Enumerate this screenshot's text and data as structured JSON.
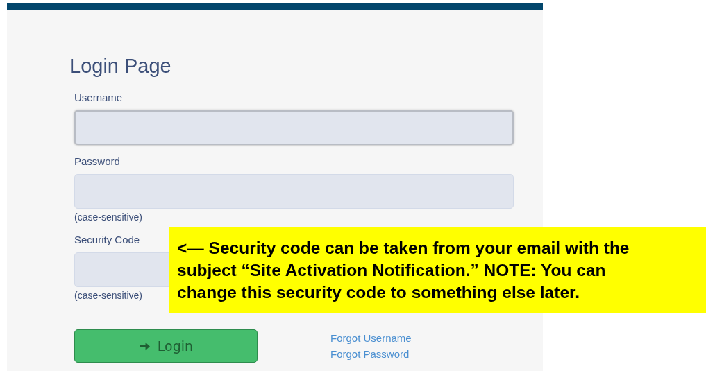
{
  "title": "Login Page",
  "fields": [
    {
      "label": "Username",
      "focused": true
    },
    {
      "label": "Password",
      "focused": false,
      "hint": "(case-sensitive)"
    },
    {
      "label": "Security Code",
      "focused": false,
      "hint": "(case-sensitive)"
    }
  ],
  "login_button": "Login",
  "links": [
    "Forgot Username",
    "Forgot Password"
  ],
  "callout": {
    "text": "<— Security code can be taken from your email with the subject “Site Activation Notification.” NOTE: You can change this security code to something else later."
  }
}
